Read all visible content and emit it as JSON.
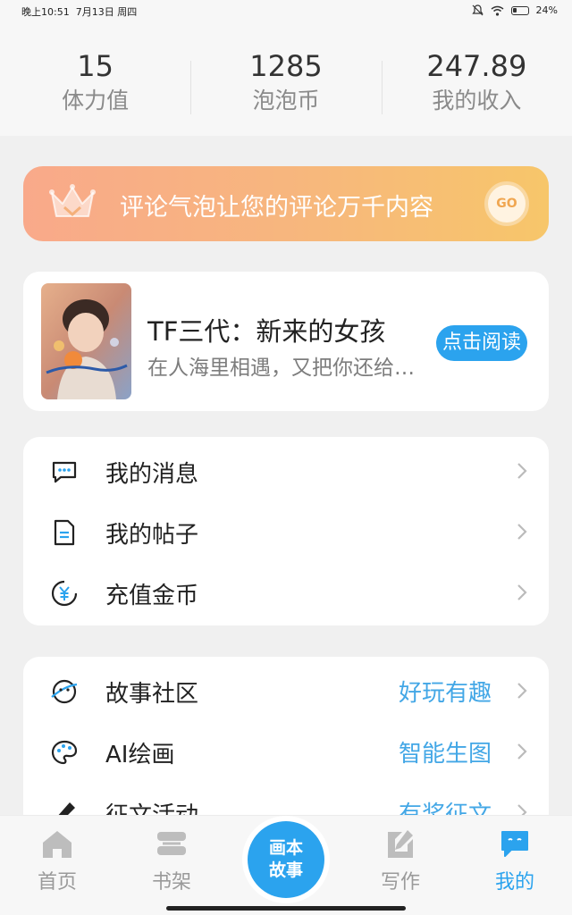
{
  "status_bar": {
    "time": "晚上10:51",
    "date": "7月13日 周四",
    "battery": "24%"
  },
  "stats": [
    {
      "value": "15",
      "label": "体力值"
    },
    {
      "value": "1285",
      "label": "泡泡币"
    },
    {
      "value": "247.89",
      "label": "我的收入"
    }
  ],
  "promo": {
    "text": "评论气泡让您的评论万千内容",
    "go_label": "GO"
  },
  "book": {
    "title": "TF三代：新来的女孩",
    "description": "在人海里相遇，又把你还给人海",
    "read_label": "点击阅读"
  },
  "menu1": [
    {
      "icon": "message-icon",
      "label": "我的消息"
    },
    {
      "icon": "document-icon",
      "label": "我的帖子"
    },
    {
      "icon": "yuan-coin-icon",
      "label": "充值金币"
    }
  ],
  "menu2": [
    {
      "icon": "planet-icon",
      "label": "故事社区",
      "extra": "好玩有趣"
    },
    {
      "icon": "palette-icon",
      "label": "AI绘画",
      "extra": "智能生图"
    },
    {
      "icon": "pen-icon",
      "label": "征文活动",
      "extra": "有奖征文"
    }
  ],
  "nav": {
    "home": "首页",
    "bookshelf": "书架",
    "center": "画本故事",
    "write": "写作",
    "mine": "我的"
  },
  "colors": {
    "accent": "#2ba3ee",
    "promo_start": "#f9a98a",
    "promo_end": "#f7c66a",
    "extra_text": "#43a7e6"
  }
}
